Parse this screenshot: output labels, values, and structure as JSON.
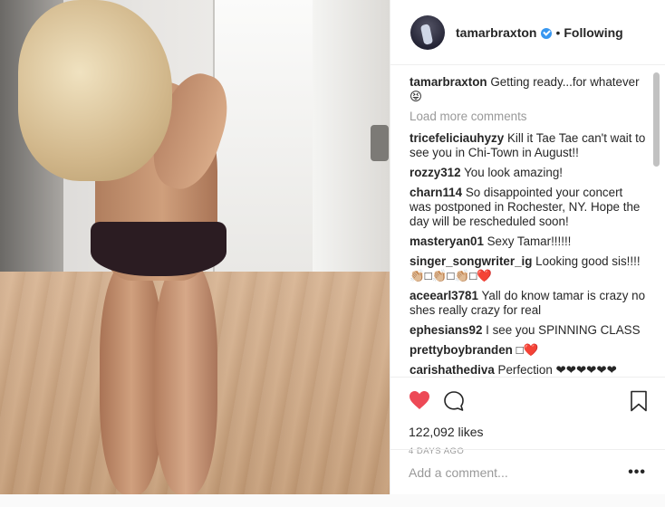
{
  "header": {
    "username": "tamarbraxton",
    "separator": "•",
    "follow_status": "Following"
  },
  "caption": {
    "username": "tamarbraxton",
    "text": "Getting ready...for whatever😝"
  },
  "load_more": "Load more comments",
  "comments": [
    {
      "user": "tricefeliciauhyzy",
      "text": "Kill it Tae Tae can't wait to see you in Chi-Town in August!!"
    },
    {
      "user": "rozzy312",
      "text": "You look amazing!"
    },
    {
      "user": "charn114",
      "text": "So disappointed your concert was postponed in Rochester, NY. Hope the day will be rescheduled soon!"
    },
    {
      "user": "masteryan01",
      "text": "Sexy Tamar!!!!!!"
    },
    {
      "user": "singer_songwriter_ig",
      "text": "Looking good sis!!!!👏🏼□👏🏼□👏🏼□❤️"
    },
    {
      "user": "aceearl3781",
      "text": "Yall do know tamar is crazy no shes really crazy for real"
    },
    {
      "user": "ephesians92",
      "text": "I see you SPINNING CLASS"
    },
    {
      "user": "prettyboybranden",
      "text": "□❤️"
    },
    {
      "user": "carishathediva",
      "text": "Perfection ❤❤❤❤❤❤"
    }
  ],
  "likes": "122,092 likes",
  "time_ago": "4 DAYS AGO",
  "add_comment": {
    "placeholder": "Add a comment..."
  },
  "more_label": "•••",
  "icons": {
    "like": "heart-icon",
    "comment": "comment-icon",
    "save": "bookmark-icon",
    "verified": "verified-badge-icon"
  },
  "colors": {
    "like_red": "#ed4956",
    "verified_blue": "#3897f0",
    "muted_text": "#999999"
  }
}
